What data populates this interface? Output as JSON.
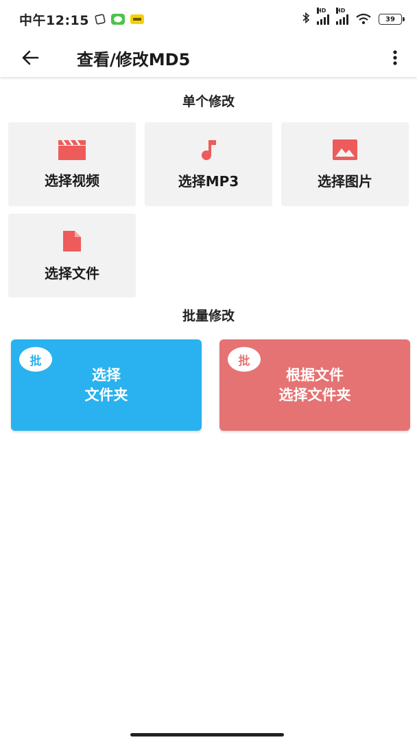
{
  "status_bar": {
    "time": "中午12:15",
    "network_1": "HD",
    "network_2": "HD",
    "battery": "39"
  },
  "app_bar": {
    "title": "查看/修改MD5"
  },
  "single": {
    "section_title": "单个修改",
    "tiles": [
      {
        "label": "选择视频",
        "icon": "video-clapper-icon"
      },
      {
        "label": "选择MP3",
        "icon": "music-note-icon"
      },
      {
        "label": "选择图片",
        "icon": "image-icon"
      },
      {
        "label": "选择文件",
        "icon": "file-icon"
      }
    ]
  },
  "batch": {
    "section_title": "批量修改",
    "left": {
      "badge": "批",
      "line1": "选择",
      "line2": "文件夹"
    },
    "right": {
      "badge": "批",
      "line1": "根据文件",
      "line2": "选择文件夹"
    }
  },
  "colors": {
    "accent_red": "#ee5b5b",
    "batch_blue": "#29b2ef",
    "batch_red": "#e57373",
    "tile_bg": "#f2f2f2"
  }
}
